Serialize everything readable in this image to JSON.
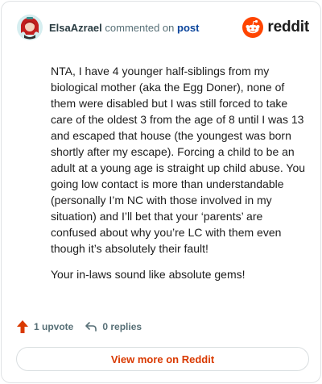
{
  "header": {
    "author": "ElsaAzrael",
    "verb": "commented on",
    "post_link": "post",
    "brand": "reddit"
  },
  "comment": {
    "paragraphs": [
      "NTA, I have 4 younger half-siblings from my biological mother (aka the Egg Doner), none of them were disabled but I was still forced to take care of the oldest 3 from the age of 8 until I was 13 and escaped that house (the youngest was born shortly after my escape). Forcing a child to be an adult at a young age is straight up child abuse. You going low contact is more than understandable (personally I’m NC with those involved in my situation) and I’ll bet that your ‘parents’ are confused about why you’re LC with them even though it’s absolutely their fault!",
      "Your in-laws sound like absolute gems!"
    ]
  },
  "actions": {
    "upvotes": "1 upvote",
    "replies": "0 replies"
  },
  "view_more": "View more on Reddit",
  "colors": {
    "brand": "#ff4500",
    "link": "#0a449b",
    "upvote": "#d93900",
    "view_more_text": "#d93900"
  }
}
